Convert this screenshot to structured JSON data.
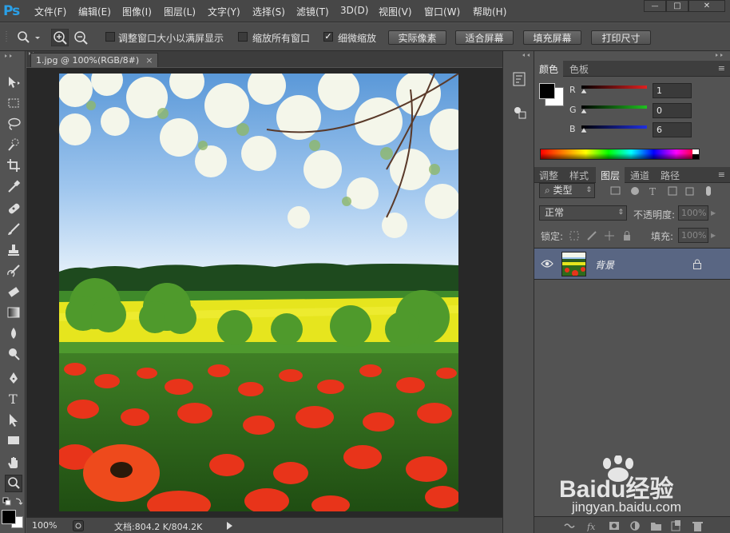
{
  "app": {
    "logo": "Ps"
  },
  "menu": [
    {
      "label": "文件(F)"
    },
    {
      "label": "编辑(E)"
    },
    {
      "label": "图像(I)"
    },
    {
      "label": "图层(L)"
    },
    {
      "label": "文字(Y)"
    },
    {
      "label": "选择(S)"
    },
    {
      "label": "滤镜(T)"
    },
    {
      "label": "3D(D)"
    },
    {
      "label": "视图(V)"
    },
    {
      "label": "窗口(W)"
    },
    {
      "label": "帮助(H)"
    }
  ],
  "window_controls": {
    "minimize": "—",
    "maximize": "□",
    "close": "✕"
  },
  "options": {
    "resize_windows_label": "调整窗口大小以满屏显示",
    "resize_windows_checked": false,
    "zoom_all_label": "缩放所有窗口",
    "zoom_all_checked": false,
    "scrubby_zoom_label": "细微缩放",
    "scrubby_zoom_checked": true,
    "actual_pixels": "实际像素",
    "fit_screen": "适合屏幕",
    "fill_screen": "填充屏幕",
    "print_size": "打印尺寸"
  },
  "document": {
    "tab_title": "1.jpg @ 100%(RGB/8#)",
    "close_symbol": "×",
    "zoom": "100%",
    "doc_size": "文档:804.2 K/804.2K"
  },
  "color_panel": {
    "tabs": [
      {
        "label": "颜色"
      },
      {
        "label": "色板"
      }
    ],
    "channels": [
      {
        "label": "R",
        "value": "1",
        "color": "#e02020"
      },
      {
        "label": "G",
        "value": "0",
        "color": "#20c020"
      },
      {
        "label": "B",
        "value": "6",
        "color": "#2030e0"
      }
    ],
    "foreground": "#000000",
    "background": "#ffffff"
  },
  "layers_panel": {
    "tabs": [
      {
        "label": "调整"
      },
      {
        "label": "样式"
      },
      {
        "label": "图层"
      },
      {
        "label": "通道"
      },
      {
        "label": "路径"
      }
    ],
    "filter_kind": "类型",
    "blend_mode": "正常",
    "opacity_label": "不透明度:",
    "opacity_value": "100%",
    "lock_label": "锁定:",
    "fill_label": "填充:",
    "fill_value": "100%",
    "layers": [
      {
        "name": "背景",
        "visible": true,
        "locked": true,
        "selected": true
      }
    ]
  },
  "watermark": {
    "brand": "Baidu经验",
    "url": "jingyan.baidu.com"
  }
}
